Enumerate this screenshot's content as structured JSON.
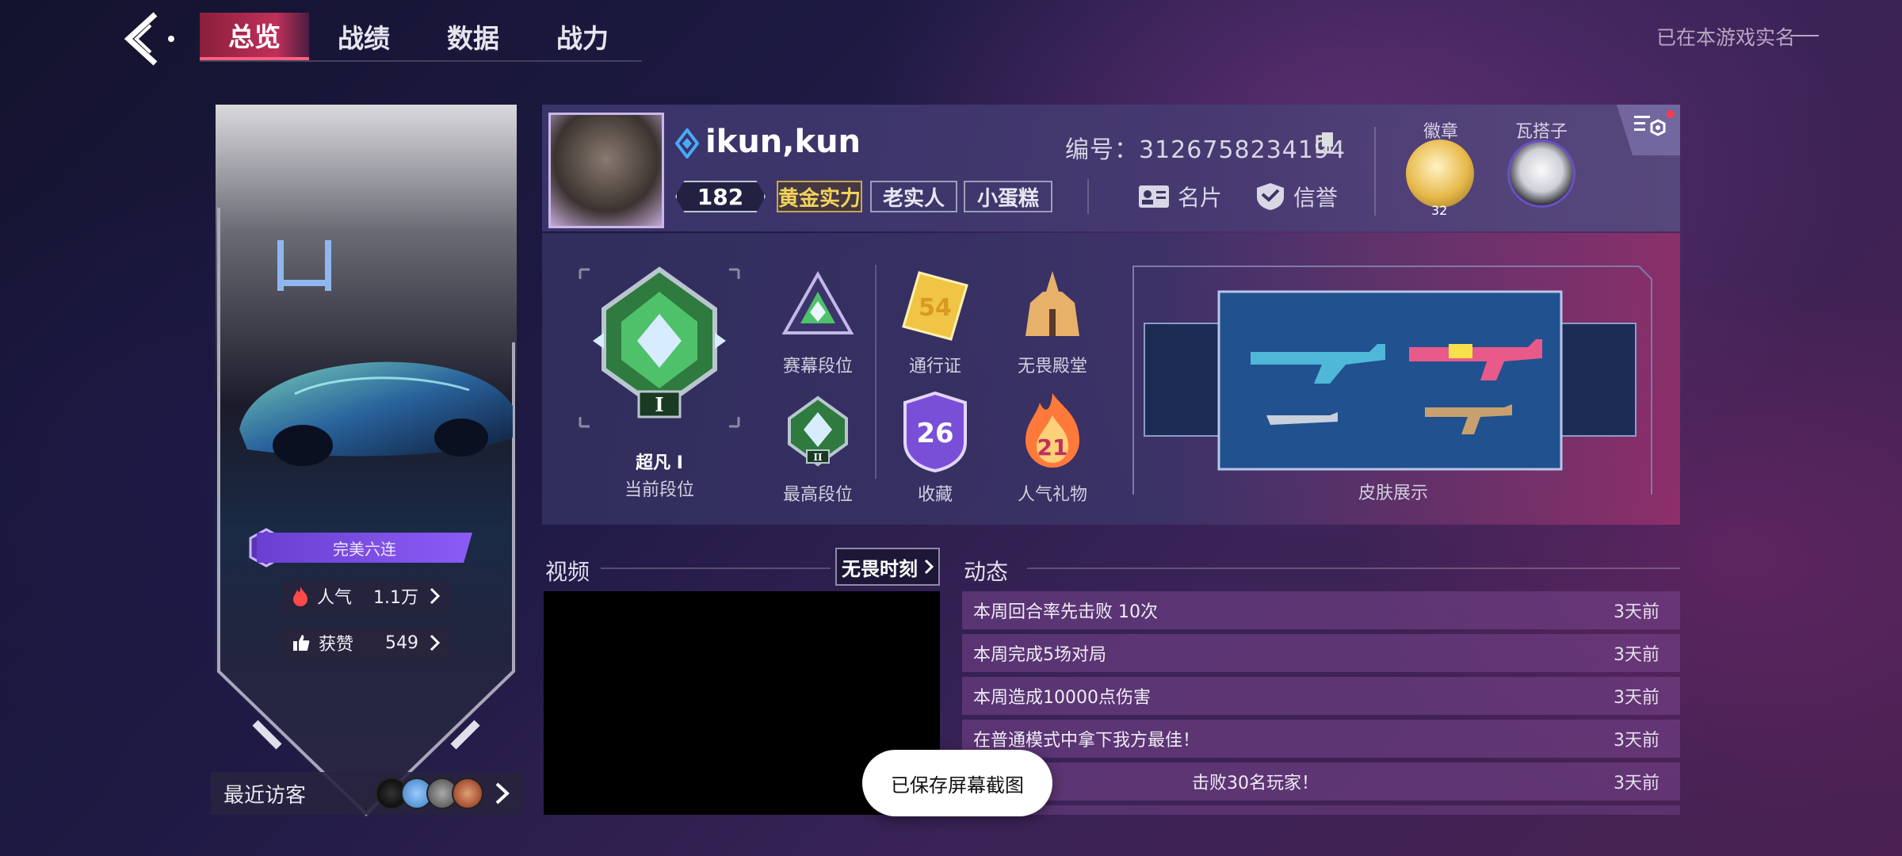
{
  "nav": {
    "tabs": [
      "总览",
      "战绩",
      "数据",
      "战力"
    ],
    "active_tab": 0,
    "realname_text": "已在本游戏实名"
  },
  "left_card": {
    "streak_number": "6",
    "streak_text": "完美六连",
    "popularity_label": "人气",
    "popularity_value": "1.1万",
    "likes_label": "获赞",
    "likes_value": "549",
    "visitors_label": "最近访客"
  },
  "profile": {
    "username": "ikun,kun",
    "level": "182",
    "tags": [
      "黄金实力",
      "老实人",
      "小蛋糕"
    ],
    "uid_text": "编号：3126758234194",
    "card_label": "名片",
    "credit_label": "信誉",
    "badge_label": "徽章",
    "badge_count": "32",
    "partner_label": "瓦搭子"
  },
  "ranks": {
    "current_rank_name": "超凡 I",
    "current_rank_label": "当前段位",
    "current_rank_numeral": "I",
    "season_rank_label": "赛幕段位",
    "highest_rank_label": "最高段位",
    "highest_rank_numeral": "II",
    "pass_label": "通行证",
    "pass_value": "54",
    "hall_label": "无畏殿堂",
    "collection_label": "收藏",
    "collection_value": "26",
    "gift_label": "人气礼物",
    "gift_value": "21",
    "skins_label": "皮肤展示"
  },
  "video": {
    "title": "视频",
    "button": "无畏时刻"
  },
  "feed": {
    "title": "动态",
    "items": [
      {
        "text": "本周回合率先击败 10次",
        "time": "3天前"
      },
      {
        "text": "本周完成5场对局",
        "time": "3天前"
      },
      {
        "text": "本周造成10000点伤害",
        "time": "3天前"
      },
      {
        "text": "在普通模式中拿下我方最佳！",
        "time": "3天前"
      },
      {
        "text": "击败30名玩家！",
        "time": "3天前"
      }
    ]
  },
  "toast": "已保存屏幕截图",
  "colors": {
    "accent_pink": "#c0305a",
    "gold": "#f2d35a",
    "purple": "#8b5cf6",
    "rank_green": "#3fae5a"
  }
}
